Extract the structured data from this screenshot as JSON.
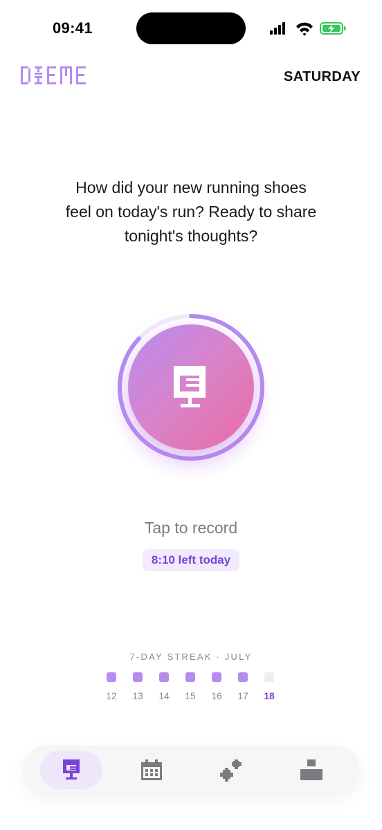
{
  "status_bar": {
    "time": "09:41",
    "icons": [
      "signal-icon",
      "wifi-icon",
      "battery-charging-icon"
    ],
    "battery_color": "#34c759"
  },
  "header": {
    "logo_text": "DIEME",
    "day": "SATURDAY"
  },
  "prompt": {
    "text": "How did your new running shoes feel on today's run? Ready to share tonight's thoughts?"
  },
  "record": {
    "label": "Tap to record",
    "time_left": "8:10 left today",
    "icon": "journal-mic-icon",
    "progress_fraction": 0.87
  },
  "streak": {
    "title": "7-DAY STREAK · JULY",
    "days": [
      {
        "num": "12",
        "done": true
      },
      {
        "num": "13",
        "done": true
      },
      {
        "num": "14",
        "done": true
      },
      {
        "num": "15",
        "done": true
      },
      {
        "num": "16",
        "done": true
      },
      {
        "num": "17",
        "done": true
      },
      {
        "num": "18",
        "done": false,
        "today": true
      }
    ]
  },
  "tabs": [
    {
      "icon": "record-icon",
      "active": true
    },
    {
      "icon": "calendar-icon",
      "active": false
    },
    {
      "icon": "sparkle-icon",
      "active": false
    },
    {
      "icon": "profile-icon",
      "active": false
    }
  ],
  "colors": {
    "accent": "#7a42d9",
    "accent_light": "#b68cf0",
    "gradient_start": "#b88cf0",
    "gradient_end": "#ec6aa6"
  }
}
